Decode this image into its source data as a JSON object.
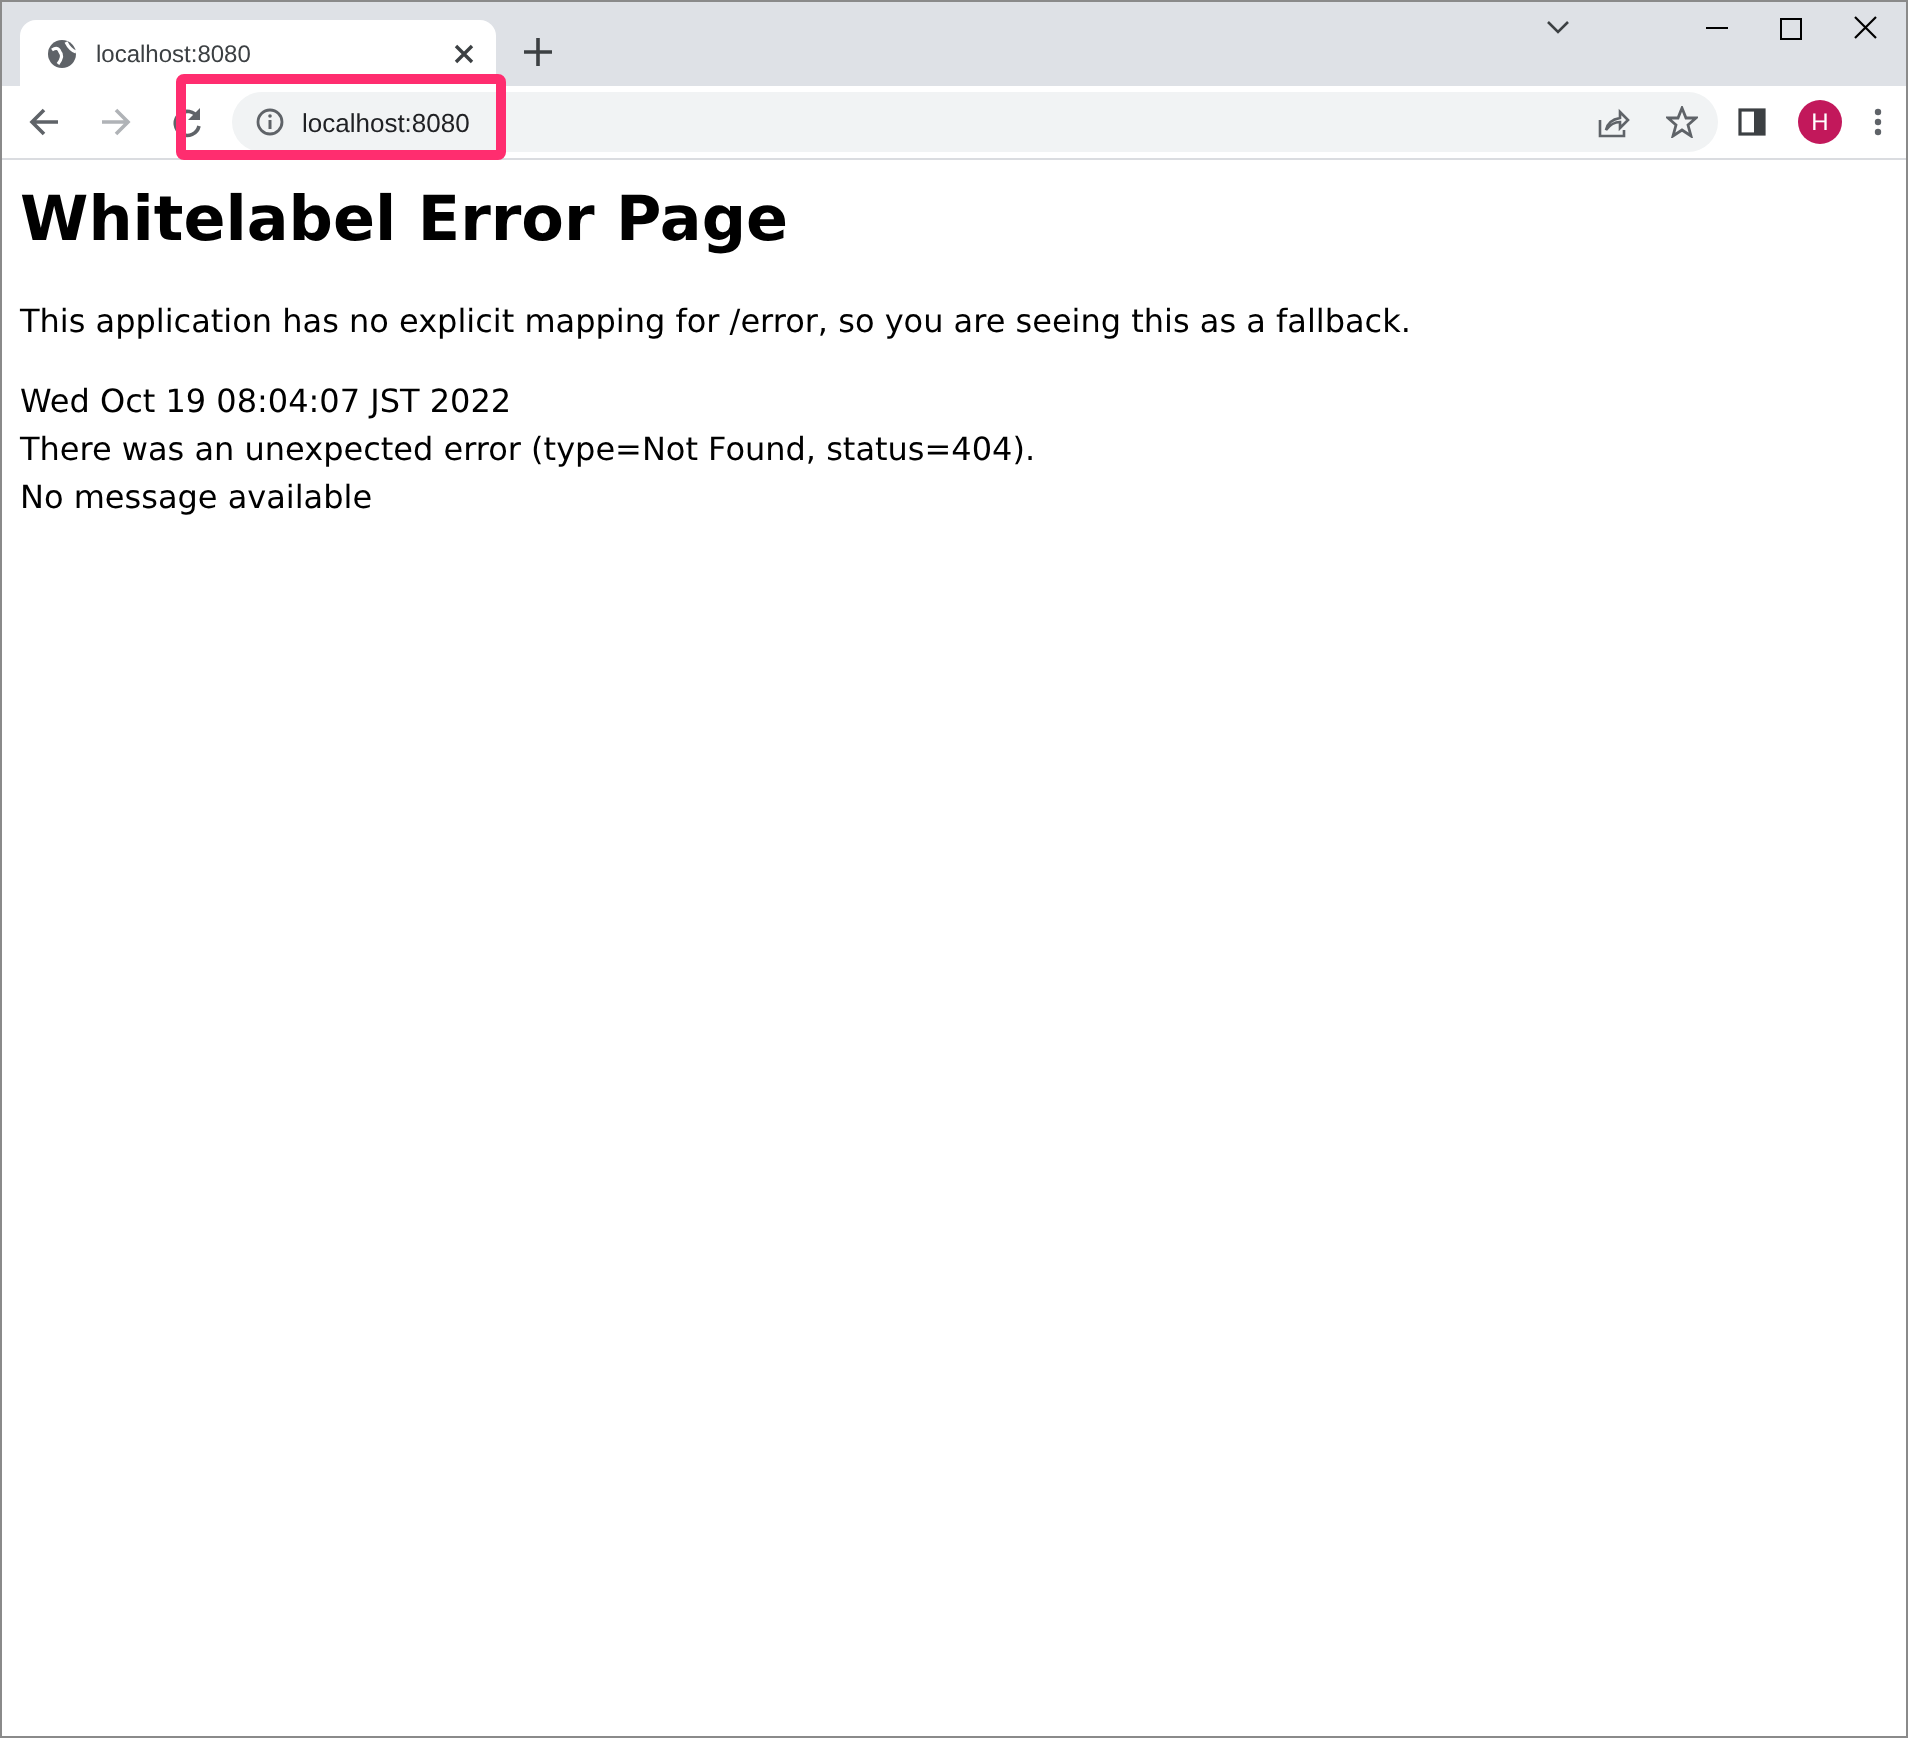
{
  "tab": {
    "title": "localhost:8080"
  },
  "address_bar": {
    "value": "localhost:8080",
    "highlighted": true
  },
  "profile": {
    "initial": "H"
  },
  "page": {
    "heading": "Whitelabel Error Page",
    "paragraphs": [
      {
        "lines": [
          "This application has no explicit mapping for /error, so you are seeing this as a fallback."
        ]
      },
      {
        "lines": [
          "Wed Oct 19 08:04:07 JST 2022",
          "There was an unexpected error (type=Not Found, status=404).",
          "No message available"
        ]
      }
    ]
  }
}
